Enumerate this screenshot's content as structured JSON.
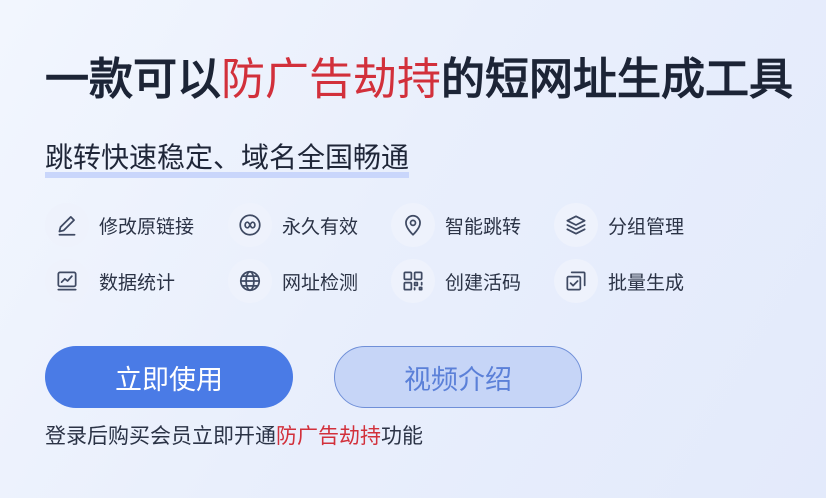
{
  "headline": {
    "prefix": "一款可以",
    "highlight": "防广告劫持",
    "suffix": "的短网址生成工具"
  },
  "subtitle": "跳转快速稳定、域名全国畅通",
  "features": [
    {
      "label": "修改原链接",
      "icon": "pen-icon"
    },
    {
      "label": "永久有效",
      "icon": "infinity-icon"
    },
    {
      "label": "智能跳转",
      "icon": "location-pin-icon"
    },
    {
      "label": "分组管理",
      "icon": "layers-icon"
    },
    {
      "label": "数据统计",
      "icon": "line-chart-icon"
    },
    {
      "label": "网址检测",
      "icon": "globe-icon"
    },
    {
      "label": "创建活码",
      "icon": "qr-code-icon"
    },
    {
      "label": "批量生成",
      "icon": "checkbox-copy-icon"
    }
  ],
  "buttons": {
    "primary": "立即使用",
    "secondary": "视频介绍"
  },
  "footnote": {
    "prefix": "登录后购买会员立即开通",
    "highlight": "防广告劫持",
    "suffix": "功能"
  },
  "colors": {
    "accent_red": "#d2303b",
    "primary_blue": "#4a7be6",
    "secondary_fill": "#c6d5f7",
    "secondary_text": "#5b80d8"
  }
}
